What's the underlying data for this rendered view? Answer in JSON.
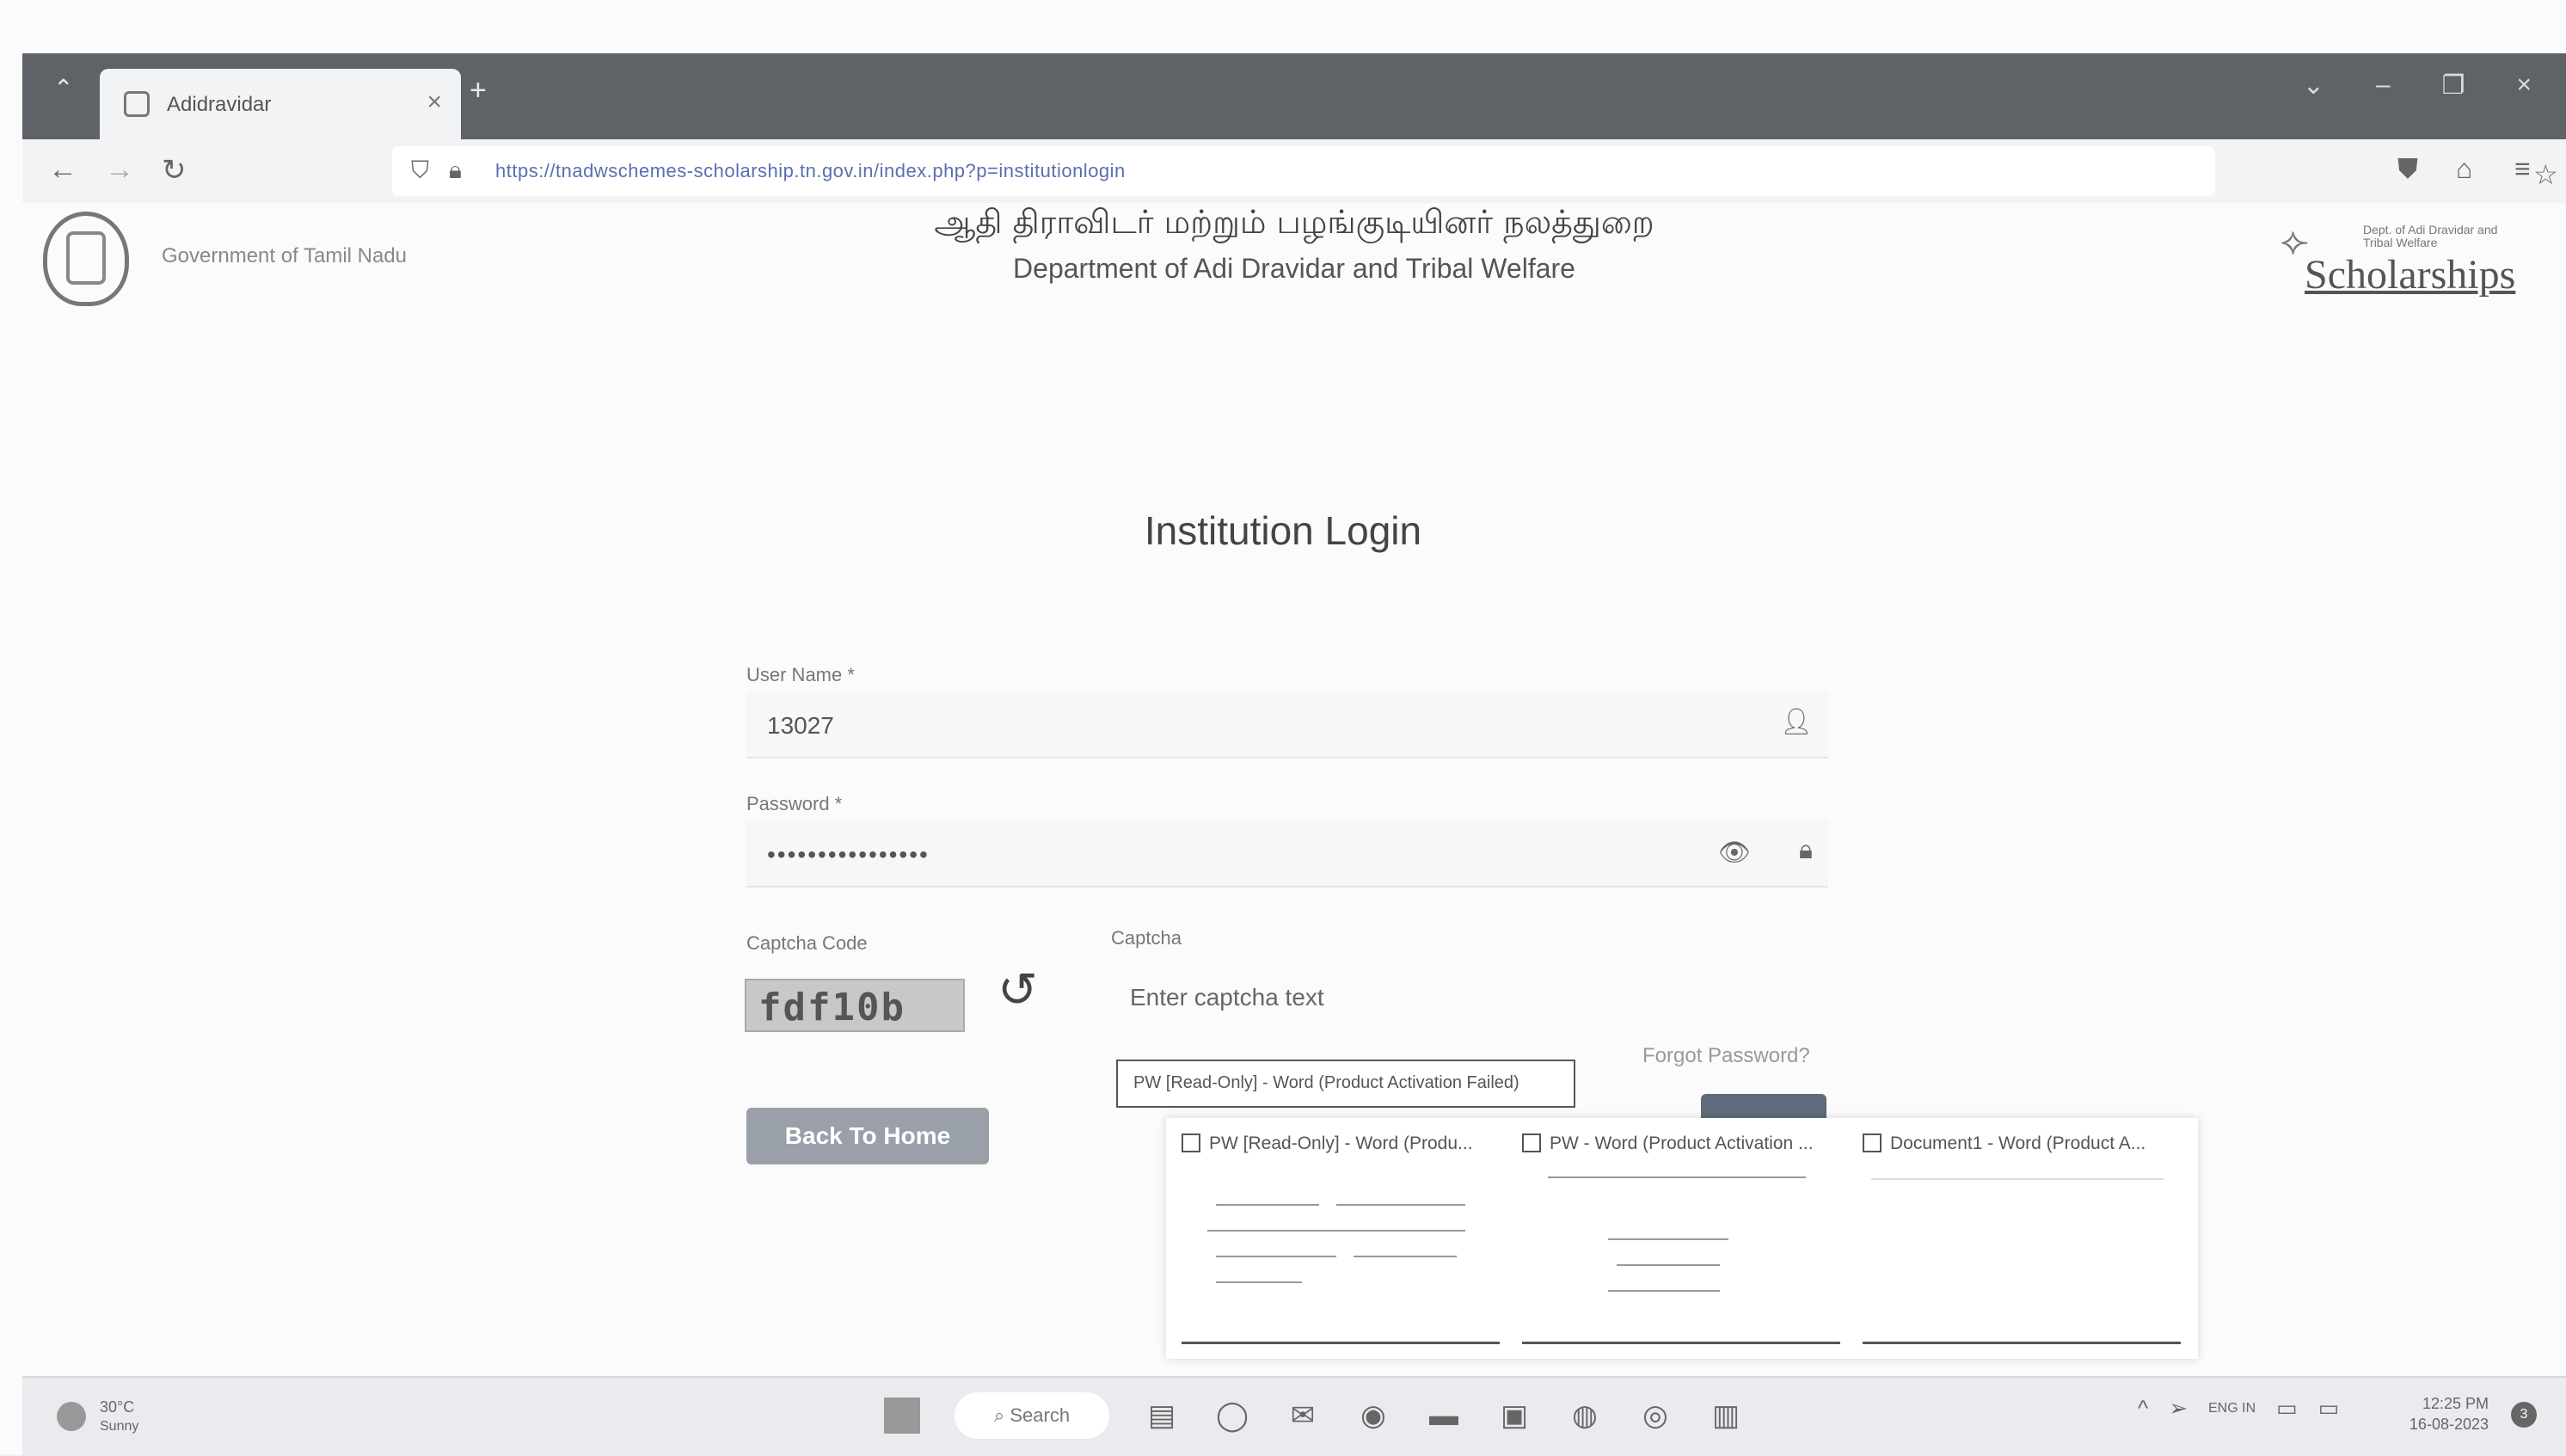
{
  "browser": {
    "tab_title": "Adidravidar",
    "url": "https://tnadwschemes-scholarship.tn.gov.in/index.php?p=institutionlogin"
  },
  "header": {
    "gov_text": "Government of Tamil Nadu",
    "title_tamil": "ஆதி திராவிடர் மற்றும் பழங்குடியினர் நலத்துறை",
    "title_english": "Department of Adi Dravidar and Tribal Welfare",
    "logo_word": "Scholarships",
    "logo_tagline": "Dept. of Adi Dravidar and Tribal Welfare"
  },
  "login": {
    "title": "Institution Login",
    "username_label": "User Name *",
    "username_value": "13027",
    "password_label": "Password *",
    "password_value": "••••••••••••••••",
    "captcha_code_label": "Captcha Code",
    "captcha_code": "fdf10b",
    "captcha_label": "Captcha",
    "captcha_placeholder": "Enter captcha text",
    "forgot_password": "Forgot Password?",
    "back_button": "Back To Home"
  },
  "taskbar_popup": {
    "tooltip": "PW [Read-Only] - Word (Product Activation Failed)",
    "previews": [
      {
        "title": "PW [Read-Only] - Word (Produ..."
      },
      {
        "title": "PW - Word (Product Activation ..."
      },
      {
        "title": "Document1 - Word (Product A..."
      }
    ]
  },
  "taskbar": {
    "temperature": "30°C",
    "weather": "Sunny",
    "search_label": "Search",
    "language": "ENG IN",
    "time": "12:25 PM",
    "date": "16-08-2023",
    "notifications": "3"
  }
}
